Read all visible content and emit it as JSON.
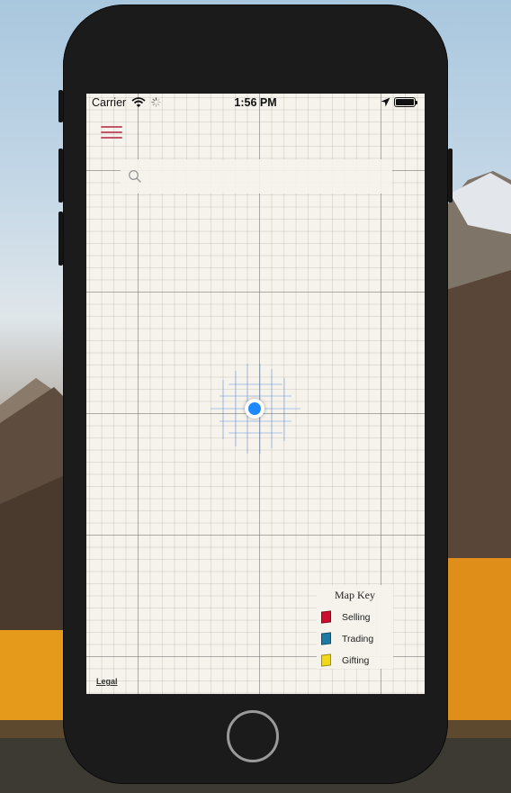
{
  "status_bar": {
    "carrier": "Carrier",
    "time": "1:56 PM",
    "icons": [
      "wifi-icon",
      "spinner-icon",
      "location-arrow-icon",
      "battery-icon"
    ]
  },
  "menu": {
    "icon": "hamburger-menu-icon",
    "color": "#c2566a"
  },
  "search": {
    "placeholder": "",
    "value": "",
    "icon": "search-icon"
  },
  "map": {
    "background": "#f6f3ec",
    "user_location_color": "#1e88ff"
  },
  "map_key": {
    "title": "Map Key",
    "items": [
      {
        "label": "Selling",
        "color": "#c8102e"
      },
      {
        "label": "Trading",
        "color": "#1f7aa3"
      },
      {
        "label": "Gifting",
        "color": "#f2d81c"
      }
    ]
  },
  "legal": {
    "label": "Legal"
  },
  "colors": {
    "phone_body": "#1b1b1b"
  }
}
